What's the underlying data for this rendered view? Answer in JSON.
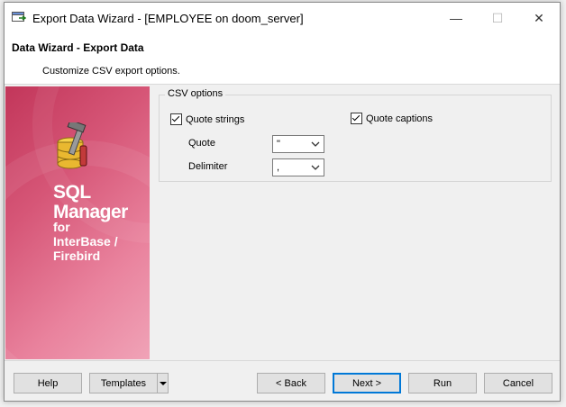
{
  "window": {
    "title": "Export Data Wizard - [EMPLOYEE on doom_server]",
    "minimize": "—",
    "maximize": "☐",
    "close": "✕"
  },
  "header": {
    "title": "Data Wizard - Export Data",
    "subtitle": "Customize CSV export options."
  },
  "sidebar": {
    "brand_line1": "SQL",
    "brand_line2": "Manager",
    "brand_line3": "for",
    "brand_line4": "InterBase /",
    "brand_line5": "Firebird",
    "icon": "database-tools-icon"
  },
  "csv_options": {
    "group_label": "CSV options",
    "quote_strings_label": "Quote strings",
    "quote_strings_checked": true,
    "quote_captions_label": "Quote captions",
    "quote_captions_checked": true,
    "quote_label": "Quote",
    "quote_value": "\"",
    "delimiter_label": "Delimiter",
    "delimiter_value": ","
  },
  "buttons": {
    "help": "Help",
    "templates": "Templates",
    "back": "< Back",
    "next": "Next >",
    "run": "Run",
    "cancel": "Cancel"
  }
}
